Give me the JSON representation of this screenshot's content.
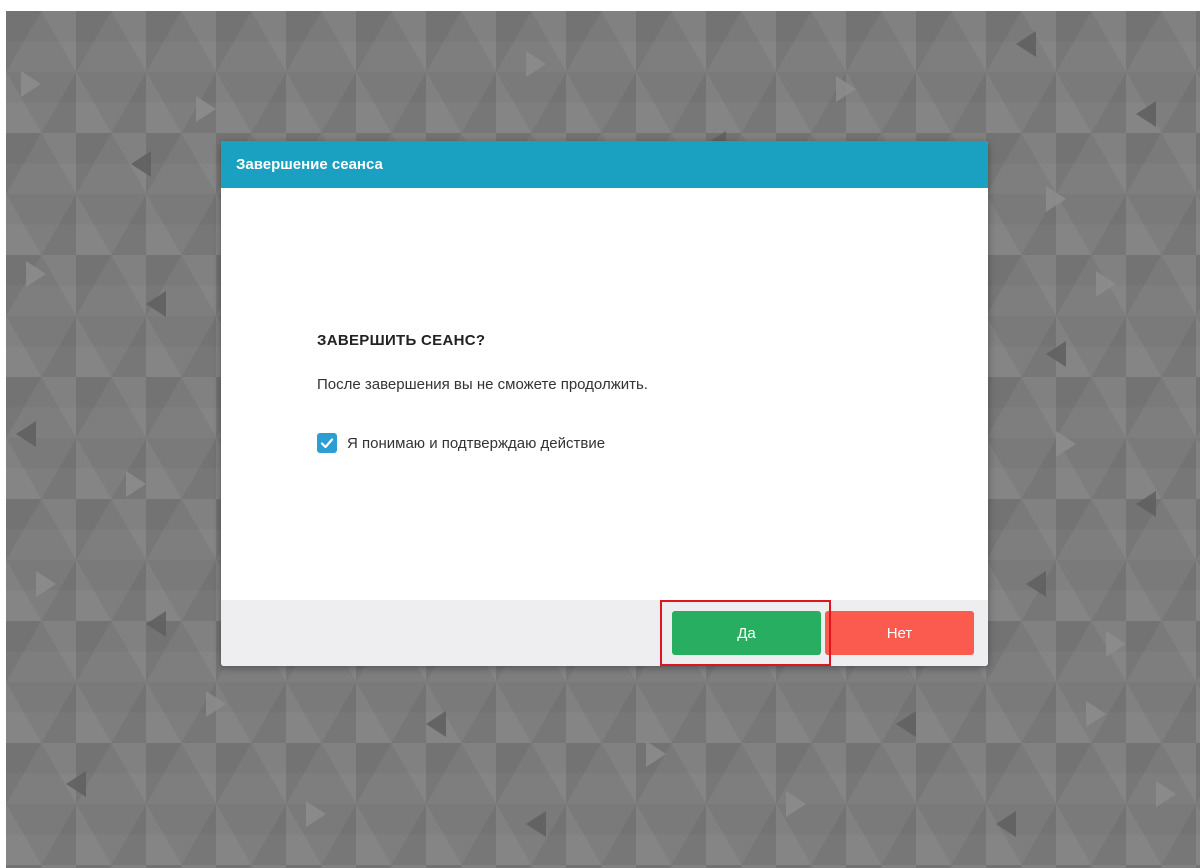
{
  "dialog": {
    "title": "Завершение сеанса",
    "question": "ЗАВЕРШИТЬ СЕАНС?",
    "message": "После завершения вы не сможете продолжить.",
    "confirm_label": "Я понимаю и подтверждаю действие",
    "confirm_checked": true,
    "yes_label": "Да",
    "no_label": "Нет"
  },
  "colors": {
    "header": "#1aa0c0",
    "yes_button": "#27ae60",
    "no_button": "#fa5b4e",
    "checkbox": "#2b9fd4",
    "highlight": "#e0141e"
  },
  "icons": {
    "checkbox": "checkmark-icon"
  }
}
